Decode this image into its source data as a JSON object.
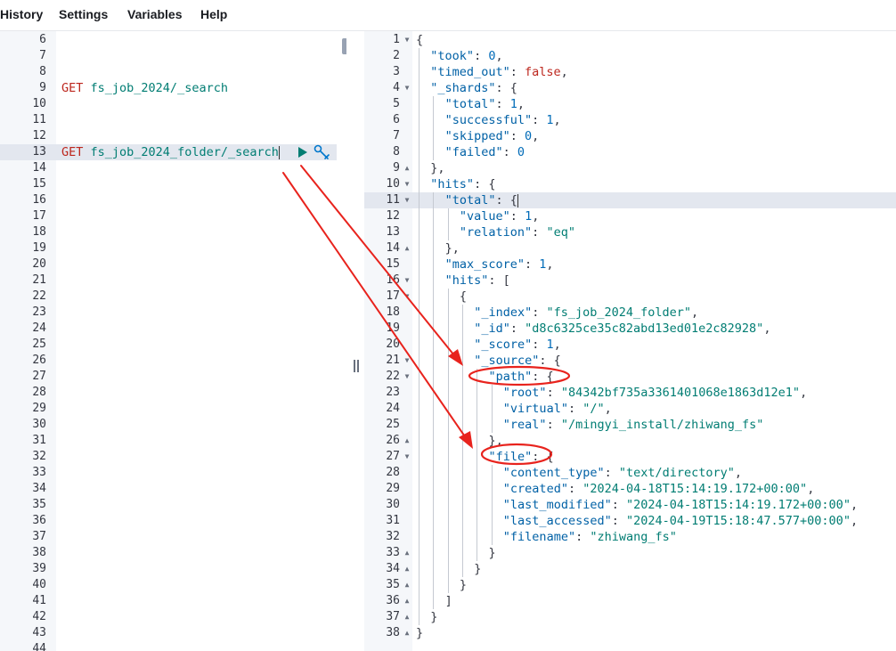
{
  "menu": [
    "History",
    "Settings",
    "Variables",
    "Help"
  ],
  "request_lines": [
    {
      "n": "6",
      "code": ""
    },
    {
      "n": "7",
      "code": ""
    },
    {
      "n": "8",
      "code": ""
    },
    {
      "n": "9",
      "method": "GET",
      "path": "fs_job_2024/_search"
    },
    {
      "n": "10",
      "code": ""
    },
    {
      "n": "11",
      "code": ""
    },
    {
      "n": "12",
      "code": ""
    },
    {
      "n": "13",
      "method": "GET",
      "path": "fs_job_2024_folder/_search",
      "active": true
    },
    {
      "n": "14"
    },
    {
      "n": "15"
    },
    {
      "n": "16"
    },
    {
      "n": "17"
    },
    {
      "n": "18"
    },
    {
      "n": "19"
    },
    {
      "n": "20"
    },
    {
      "n": "21"
    },
    {
      "n": "22"
    },
    {
      "n": "23"
    },
    {
      "n": "24"
    },
    {
      "n": "25"
    },
    {
      "n": "26"
    },
    {
      "n": "27"
    },
    {
      "n": "28"
    },
    {
      "n": "29"
    },
    {
      "n": "30"
    },
    {
      "n": "31"
    },
    {
      "n": "32"
    },
    {
      "n": "33"
    },
    {
      "n": "34"
    },
    {
      "n": "35"
    },
    {
      "n": "36"
    },
    {
      "n": "37"
    },
    {
      "n": "38"
    },
    {
      "n": "39"
    },
    {
      "n": "40"
    },
    {
      "n": "41"
    },
    {
      "n": "42"
    },
    {
      "n": "43"
    },
    {
      "n": "44"
    }
  ],
  "response_lines": [
    {
      "n": "1",
      "indent": 0,
      "fold": "open",
      "tokens": [
        [
          "p",
          "{"
        ]
      ]
    },
    {
      "n": "2",
      "indent": 1,
      "tokens": [
        [
          "k",
          "\"took\""
        ],
        [
          "p",
          ": "
        ],
        [
          "n",
          "0"
        ],
        [
          "p",
          ","
        ]
      ]
    },
    {
      "n": "3",
      "indent": 1,
      "tokens": [
        [
          "k",
          "\"timed_out\""
        ],
        [
          "p",
          ": "
        ],
        [
          "b",
          "false"
        ],
        [
          "p",
          ","
        ]
      ]
    },
    {
      "n": "4",
      "indent": 1,
      "fold": "open",
      "tokens": [
        [
          "k",
          "\"_shards\""
        ],
        [
          "p",
          ": {"
        ]
      ]
    },
    {
      "n": "5",
      "indent": 2,
      "tokens": [
        [
          "k",
          "\"total\""
        ],
        [
          "p",
          ": "
        ],
        [
          "n",
          "1"
        ],
        [
          "p",
          ","
        ]
      ]
    },
    {
      "n": "6",
      "indent": 2,
      "tokens": [
        [
          "k",
          "\"successful\""
        ],
        [
          "p",
          ": "
        ],
        [
          "n",
          "1"
        ],
        [
          "p",
          ","
        ]
      ]
    },
    {
      "n": "7",
      "indent": 2,
      "tokens": [
        [
          "k",
          "\"skipped\""
        ],
        [
          "p",
          ": "
        ],
        [
          "n",
          "0"
        ],
        [
          "p",
          ","
        ]
      ]
    },
    {
      "n": "8",
      "indent": 2,
      "tokens": [
        [
          "k",
          "\"failed\""
        ],
        [
          "p",
          ": "
        ],
        [
          "n",
          "0"
        ]
      ]
    },
    {
      "n": "9",
      "indent": 1,
      "fold": "close",
      "tokens": [
        [
          "p",
          "},"
        ]
      ]
    },
    {
      "n": "10",
      "indent": 1,
      "fold": "open",
      "tokens": [
        [
          "k",
          "\"hits\""
        ],
        [
          "p",
          ": {"
        ]
      ]
    },
    {
      "n": "11",
      "indent": 2,
      "fold": "open",
      "highlight": true,
      "tokens": [
        [
          "k",
          "\"total\""
        ],
        [
          "p",
          ": {"
        ]
      ]
    },
    {
      "n": "12",
      "indent": 3,
      "tokens": [
        [
          "k",
          "\"value\""
        ],
        [
          "p",
          ": "
        ],
        [
          "n",
          "1"
        ],
        [
          "p",
          ","
        ]
      ]
    },
    {
      "n": "13",
      "indent": 3,
      "tokens": [
        [
          "k",
          "\"relation\""
        ],
        [
          "p",
          ": "
        ],
        [
          "s",
          "\"eq\""
        ]
      ]
    },
    {
      "n": "14",
      "indent": 2,
      "fold": "close",
      "tokens": [
        [
          "p",
          "},"
        ]
      ]
    },
    {
      "n": "15",
      "indent": 2,
      "tokens": [
        [
          "k",
          "\"max_score\""
        ],
        [
          "p",
          ": "
        ],
        [
          "n",
          "1"
        ],
        [
          "p",
          ","
        ]
      ]
    },
    {
      "n": "16",
      "indent": 2,
      "fold": "open",
      "tokens": [
        [
          "k",
          "\"hits\""
        ],
        [
          "p",
          ": ["
        ]
      ]
    },
    {
      "n": "17",
      "indent": 3,
      "fold": "open",
      "tokens": [
        [
          "p",
          "{"
        ]
      ]
    },
    {
      "n": "18",
      "indent": 4,
      "tokens": [
        [
          "k",
          "\"_index\""
        ],
        [
          "p",
          ": "
        ],
        [
          "s",
          "\"fs_job_2024_folder\""
        ],
        [
          "p",
          ","
        ]
      ]
    },
    {
      "n": "19",
      "indent": 4,
      "tokens": [
        [
          "k",
          "\"_id\""
        ],
        [
          "p",
          ": "
        ],
        [
          "s",
          "\"d8c6325ce35c82abd13ed01e2c82928\""
        ],
        [
          "p",
          ","
        ]
      ]
    },
    {
      "n": "20",
      "indent": 4,
      "tokens": [
        [
          "k",
          "\"_score\""
        ],
        [
          "p",
          ": "
        ],
        [
          "n",
          "1"
        ],
        [
          "p",
          ","
        ]
      ]
    },
    {
      "n": "21",
      "indent": 4,
      "fold": "open",
      "tokens": [
        [
          "k",
          "\"_source\""
        ],
        [
          "p",
          ": {"
        ]
      ]
    },
    {
      "n": "22",
      "indent": 5,
      "fold": "open",
      "tokens": [
        [
          "k",
          "\"path\""
        ],
        [
          "p",
          ": {"
        ]
      ]
    },
    {
      "n": "23",
      "indent": 6,
      "tokens": [
        [
          "k",
          "\"root\""
        ],
        [
          "p",
          ": "
        ],
        [
          "s",
          "\"84342bf735a3361401068e1863d12e1\""
        ],
        [
          "p",
          ","
        ]
      ]
    },
    {
      "n": "24",
      "indent": 6,
      "tokens": [
        [
          "k",
          "\"virtual\""
        ],
        [
          "p",
          ": "
        ],
        [
          "s",
          "\"/\""
        ],
        [
          "p",
          ","
        ]
      ]
    },
    {
      "n": "25",
      "indent": 6,
      "tokens": [
        [
          "k",
          "\"real\""
        ],
        [
          "p",
          ": "
        ],
        [
          "s",
          "\"/mingyi_install/zhiwang_fs\""
        ]
      ]
    },
    {
      "n": "26",
      "indent": 5,
      "fold": "close",
      "tokens": [
        [
          "p",
          "},"
        ]
      ]
    },
    {
      "n": "27",
      "indent": 5,
      "fold": "open",
      "tokens": [
        [
          "k",
          "\"file\""
        ],
        [
          "p",
          ": {"
        ]
      ]
    },
    {
      "n": "28",
      "indent": 6,
      "tokens": [
        [
          "k",
          "\"content_type\""
        ],
        [
          "p",
          ": "
        ],
        [
          "s",
          "\"text/directory\""
        ],
        [
          "p",
          ","
        ]
      ]
    },
    {
      "n": "29",
      "indent": 6,
      "tokens": [
        [
          "k",
          "\"created\""
        ],
        [
          "p",
          ": "
        ],
        [
          "s",
          "\"2024-04-18T15:14:19.172+00:00\""
        ],
        [
          "p",
          ","
        ]
      ]
    },
    {
      "n": "30",
      "indent": 6,
      "tokens": [
        [
          "k",
          "\"last_modified\""
        ],
        [
          "p",
          ": "
        ],
        [
          "s",
          "\"2024-04-18T15:14:19.172+00:00\""
        ],
        [
          "p",
          ","
        ]
      ]
    },
    {
      "n": "31",
      "indent": 6,
      "tokens": [
        [
          "k",
          "\"last_accessed\""
        ],
        [
          "p",
          ": "
        ],
        [
          "s",
          "\"2024-04-19T15:18:47.577+00:00\""
        ],
        [
          "p",
          ","
        ]
      ]
    },
    {
      "n": "32",
      "indent": 6,
      "tokens": [
        [
          "k",
          "\"filename\""
        ],
        [
          "p",
          ": "
        ],
        [
          "s",
          "\"zhiwang_fs\""
        ]
      ]
    },
    {
      "n": "33",
      "indent": 5,
      "fold": "close",
      "tokens": [
        [
          "p",
          "}"
        ]
      ]
    },
    {
      "n": "34",
      "indent": 4,
      "fold": "close",
      "tokens": [
        [
          "p",
          "}"
        ]
      ]
    },
    {
      "n": "35",
      "indent": 3,
      "fold": "close",
      "tokens": [
        [
          "p",
          "}"
        ]
      ]
    },
    {
      "n": "36",
      "indent": 2,
      "fold": "close",
      "tokens": [
        [
          "p",
          "]"
        ]
      ]
    },
    {
      "n": "37",
      "indent": 1,
      "fold": "close",
      "tokens": [
        [
          "p",
          "}"
        ]
      ]
    },
    {
      "n": "38",
      "indent": 0,
      "fold": "close",
      "tokens": [
        [
          "p",
          "}"
        ]
      ]
    }
  ],
  "colors": {
    "annotation": "#e8231d",
    "run": "#017d73",
    "wrench": "#0077cc"
  },
  "icons": {
    "run": "play-triangle-icon",
    "settings": "wrench-icon"
  }
}
